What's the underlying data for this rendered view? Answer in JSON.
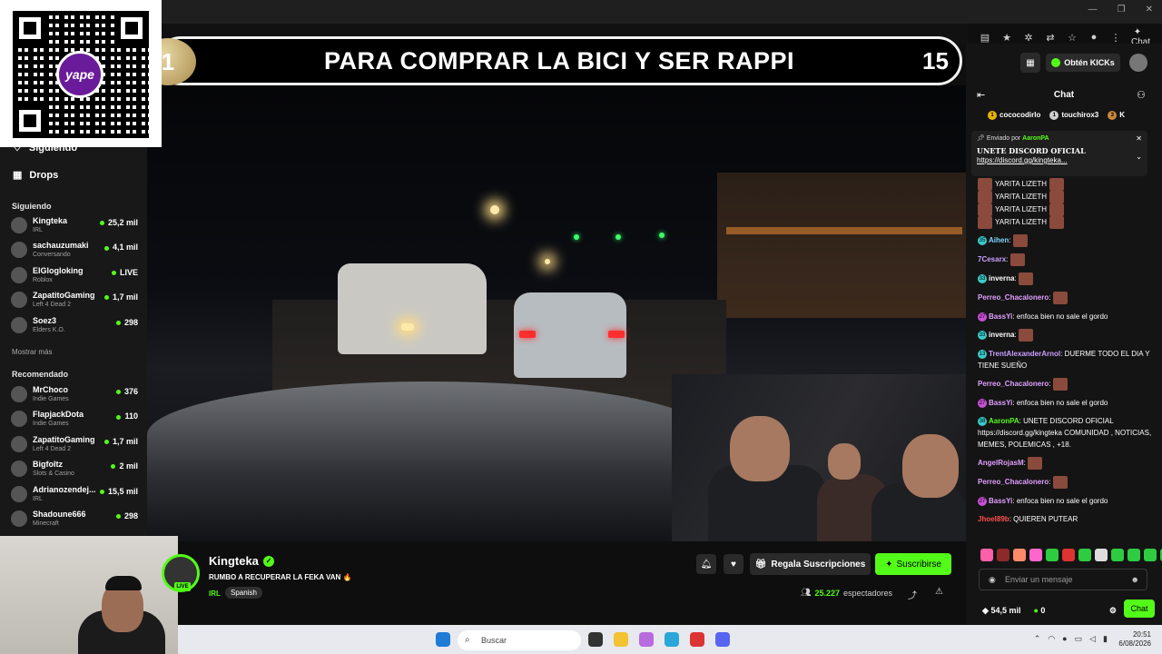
{
  "browser": {
    "chat_button_label": "Chat"
  },
  "overlay": {
    "goal_title": "PARA COMPRAR LA BICI Y SER RAPPI",
    "rank": "1",
    "count": "15",
    "qr_brand": "yape"
  },
  "topbar": {
    "kicks_label": "Obtén KICKs"
  },
  "sidebar": {
    "siguiendo_nav": "Siguiendo",
    "drops_label": "Drops",
    "following_header": "Siguiendo",
    "following": [
      {
        "name": "Kingteka",
        "category": "IRL",
        "viewers": "25,2 mil"
      },
      {
        "name": "sachauzumaki",
        "category": "Conversando",
        "viewers": "4,1 mil"
      },
      {
        "name": "ElGlogloking",
        "category": "Roblox",
        "viewers": "LIVE"
      },
      {
        "name": "ZapatitoGaming",
        "category": "Left 4 Dead 2",
        "viewers": "1,7 mil"
      },
      {
        "name": "Soez3",
        "category": "Elders K.O.",
        "viewers": "298"
      }
    ],
    "show_more": "Mostrar más",
    "recommended_header": "Recomendado",
    "recommended": [
      {
        "name": "MrChoco",
        "category": "Indie Games",
        "viewers": "376"
      },
      {
        "name": "FlapjackDota",
        "category": "Indie Games",
        "viewers": "110"
      },
      {
        "name": "ZapatitoGaming",
        "category": "Left 4 Dead 2",
        "viewers": "1,7 mil"
      },
      {
        "name": "Bigfoltz",
        "category": "Slots & Casino",
        "viewers": "2 mil"
      },
      {
        "name": "Adrianozendej...",
        "category": "IRL",
        "viewers": "15,5 mil"
      },
      {
        "name": "Shadoune666",
        "category": "Minecraft",
        "viewers": "298"
      }
    ]
  },
  "stream": {
    "streamer": "Kingteka",
    "title": "RUMBO A RECUPERAR LA FEKA VAN 🔥",
    "category": "IRL",
    "language": "Spanish",
    "live_badge": "LIVE",
    "gift_label": "Regala Suscripciones",
    "subscribe_label": "Suscribirse",
    "viewers": "25.227",
    "viewers_label": "espectadores"
  },
  "chat": {
    "header": "Chat",
    "gifters": [
      {
        "name": "cococodirlo",
        "count": "1",
        "color": "#e8b400"
      },
      {
        "name": "touchirox3",
        "count": "1",
        "color": "#cfcfcf"
      },
      {
        "name": "K",
        "count": "3",
        "color": "#c8873a"
      }
    ],
    "pinned": {
      "sent_by_label": "Enviado por",
      "sent_by_user": "AaronPA",
      "line1": "UNETE DISCORD OFICIAL",
      "line2": "https://discord.gg/kingteka..."
    },
    "spam_text": "YARITA LIZETH",
    "messages": [
      {
        "user": "Aihen",
        "text": "",
        "color": "#7fd6ff",
        "badge": "#3ac9c9",
        "level": "35",
        "emote": true
      },
      {
        "user": "7Cesarx",
        "text": "",
        "color": "#c9a0ff",
        "badge": "",
        "level": "",
        "emote": true
      },
      {
        "user": "inverna",
        "text": "",
        "color": "#ffffff",
        "badge": "#3ac9c9",
        "level": "33",
        "emote": true
      },
      {
        "user": "Perreo_Chacalonero",
        "text": "",
        "color": "#e0a0ff",
        "badge": "",
        "level": "",
        "emote": true
      },
      {
        "user": "BassYi",
        "text": "enfoca bien no sale el gordo",
        "color": "#e0a0ff",
        "badge": "#c84fd6",
        "level": "27",
        "emote": false
      },
      {
        "user": "inverna",
        "text": "",
        "color": "#ffffff",
        "badge": "#3ac9c9",
        "level": "33",
        "emote": true
      },
      {
        "user": "TrentAlexanderArnol",
        "text": "DUERME TODO EL DIA Y TIENE SUEÑO",
        "color": "#c9a0ff",
        "badge": "#3ac9c9",
        "level": "13",
        "emote": false
      },
      {
        "user": "Perreo_Chacalonero",
        "text": "",
        "color": "#e0a0ff",
        "badge": "",
        "level": "",
        "emote": true
      },
      {
        "user": "BassYi",
        "text": "enfoca bien no sale el gordo",
        "color": "#e0a0ff",
        "badge": "#c84fd6",
        "level": "27",
        "emote": false
      },
      {
        "user": "AaronPA",
        "text": "UNETE DISCORD OFICIAL https://discord.gg/kingteka COMUNIDAD , NOTICIAS, MEMES, POLEMICAS , +18.",
        "color": "#53fc18",
        "badge": "#3ac9c9",
        "level": "38",
        "emote": false
      },
      {
        "user": "AngelRojasM",
        "text": "",
        "color": "#e0a0ff",
        "badge": "",
        "level": "",
        "emote": true
      },
      {
        "user": "Perreo_Chacalonero",
        "text": "",
        "color": "#e0a0ff",
        "badge": "",
        "level": "",
        "emote": true
      },
      {
        "user": "BassYi",
        "text": "enfoca bien no sale el gordo",
        "color": "#e0a0ff",
        "badge": "#c84fd6",
        "level": "27",
        "emote": false
      },
      {
        "user": "Jhoel89b",
        "text": "QUIEREN PUTEAR",
        "color": "#ff4d4d",
        "badge": "",
        "level": "",
        "emote": false
      }
    ],
    "input_placeholder": "Enviar un mensaje",
    "points": "54,5 mil",
    "kicks_count": "0",
    "send_label": "Chat"
  },
  "taskbar": {
    "search_placeholder": "Buscar",
    "time": "20:51",
    "date": "6/08/2026"
  },
  "colors": {
    "accent": "#53fc18",
    "background": "#0f0f0f",
    "chat_bg": "#141414"
  }
}
